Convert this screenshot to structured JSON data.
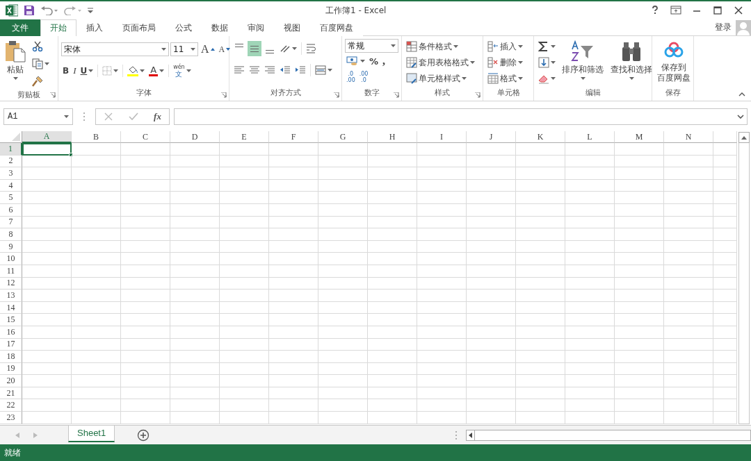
{
  "window": {
    "title": "工作簿1 - Excel"
  },
  "tabs": [
    {
      "label": "文件",
      "kind": "file",
      "selected": false
    },
    {
      "label": "开始",
      "kind": "tab",
      "selected": true
    },
    {
      "label": "插入",
      "kind": "tab",
      "selected": false
    },
    {
      "label": "页面布局",
      "kind": "tab",
      "selected": false
    },
    {
      "label": "公式",
      "kind": "tab",
      "selected": false
    },
    {
      "label": "数据",
      "kind": "tab",
      "selected": false
    },
    {
      "label": "审阅",
      "kind": "tab",
      "selected": false
    },
    {
      "label": "视图",
      "kind": "tab",
      "selected": false
    },
    {
      "label": "百度网盘",
      "kind": "tab",
      "selected": false
    }
  ],
  "account": {
    "label": "登录"
  },
  "ribbon": {
    "groups": [
      {
        "kind": "clipboard",
        "label": "剪贴板",
        "paste": "粘贴"
      },
      {
        "kind": "font",
        "label": "字体",
        "font_name": "宋体",
        "font_size": "11",
        "grow": "A",
        "shrink": "A",
        "bold": "B",
        "italic": "I",
        "underline": "U",
        "font_color": "A",
        "phonetic_top": "wén",
        "phonetic_bottom": "文"
      },
      {
        "kind": "alignment",
        "label": "对齐方式",
        "vertical_align": [
          {
            "selected": false
          },
          {
            "selected": true
          },
          {
            "selected": false
          }
        ]
      },
      {
        "kind": "number",
        "label": "数字",
        "format": "常规",
        "percent": "%",
        "comma": ",",
        "increase_decimal": [
          ".0",
          ".00"
        ],
        "decrease_decimal": [
          ".00",
          ".0"
        ]
      },
      {
        "kind": "styles",
        "label": "样式",
        "items": [
          "条件格式",
          "套用表格格式",
          "单元格样式"
        ]
      },
      {
        "kind": "cells",
        "label": "单元格",
        "items": [
          "插入",
          "删除",
          "格式"
        ]
      },
      {
        "kind": "editing",
        "label": "编辑",
        "sort": "排序和筛选",
        "find": "查找和选择"
      },
      {
        "kind": "save",
        "label": "保存",
        "button_lines": [
          "保存到",
          "百度网盘"
        ]
      }
    ]
  },
  "formula_bar": {
    "name_box": "A1",
    "function_button": "fx"
  },
  "grid": {
    "columns": [
      {
        "label": "A",
        "selected": true
      },
      {
        "label": "B",
        "selected": false
      },
      {
        "label": "C",
        "selected": false
      },
      {
        "label": "D",
        "selected": false
      },
      {
        "label": "E",
        "selected": false
      },
      {
        "label": "F",
        "selected": false
      },
      {
        "label": "G",
        "selected": false
      },
      {
        "label": "H",
        "selected": false
      },
      {
        "label": "I",
        "selected": false
      },
      {
        "label": "J",
        "selected": false
      },
      {
        "label": "K",
        "selected": false
      },
      {
        "label": "L",
        "selected": false
      },
      {
        "label": "M",
        "selected": false
      },
      {
        "label": "N",
        "selected": false
      }
    ],
    "rows": [
      {
        "label": "1",
        "selected": true
      },
      {
        "label": "2",
        "selected": false
      },
      {
        "label": "3",
        "selected": false
      },
      {
        "label": "4",
        "selected": false
      },
      {
        "label": "5",
        "selected": false
      },
      {
        "label": "6",
        "selected": false
      },
      {
        "label": "7",
        "selected": false
      },
      {
        "label": "8",
        "selected": false
      },
      {
        "label": "9",
        "selected": false
      },
      {
        "label": "10",
        "selected": false
      },
      {
        "label": "11",
        "selected": false
      },
      {
        "label": "12",
        "selected": false
      },
      {
        "label": "13",
        "selected": false
      },
      {
        "label": "14",
        "selected": false
      },
      {
        "label": "15",
        "selected": false
      },
      {
        "label": "16",
        "selected": false
      },
      {
        "label": "17",
        "selected": false
      },
      {
        "label": "18",
        "selected": false
      },
      {
        "label": "19",
        "selected": false
      },
      {
        "label": "20",
        "selected": false
      },
      {
        "label": "21",
        "selected": false
      },
      {
        "label": "22",
        "selected": false
      },
      {
        "label": "23",
        "selected": false
      }
    ]
  },
  "sheets": [
    {
      "label": "Sheet1",
      "selected": true
    }
  ],
  "status_bar": {
    "text": "就绪"
  }
}
